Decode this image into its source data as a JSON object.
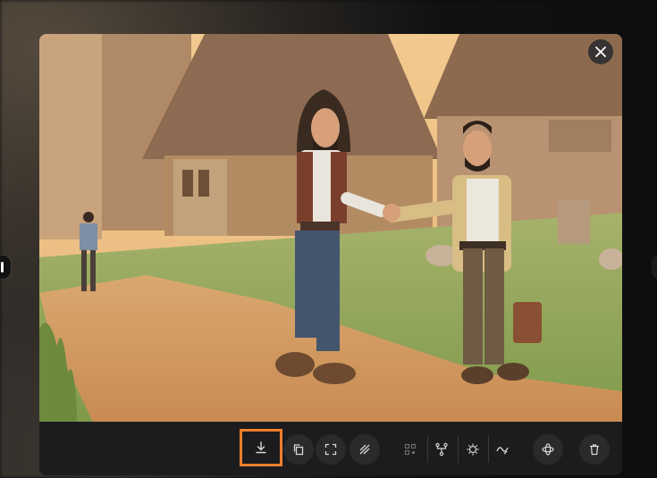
{
  "viewer": {
    "image": {
      "description_icon": "image-preview-icon"
    },
    "close_button": {
      "icon": "close-icon"
    },
    "toolbar": {
      "buttons": [
        {
          "icon": "download-icon"
        },
        {
          "icon": "copy-icon"
        },
        {
          "icon": "expand-icon"
        },
        {
          "icon": "hatch-icon"
        },
        {
          "icon": "qr-icon"
        },
        {
          "icon": "branch-icon"
        },
        {
          "icon": "sparkle-icon"
        },
        {
          "icon": "wave-icon"
        },
        {
          "icon": "orbit-icon"
        },
        {
          "icon": "trash-icon"
        }
      ],
      "highlight_color": "#ee7f2d"
    }
  }
}
